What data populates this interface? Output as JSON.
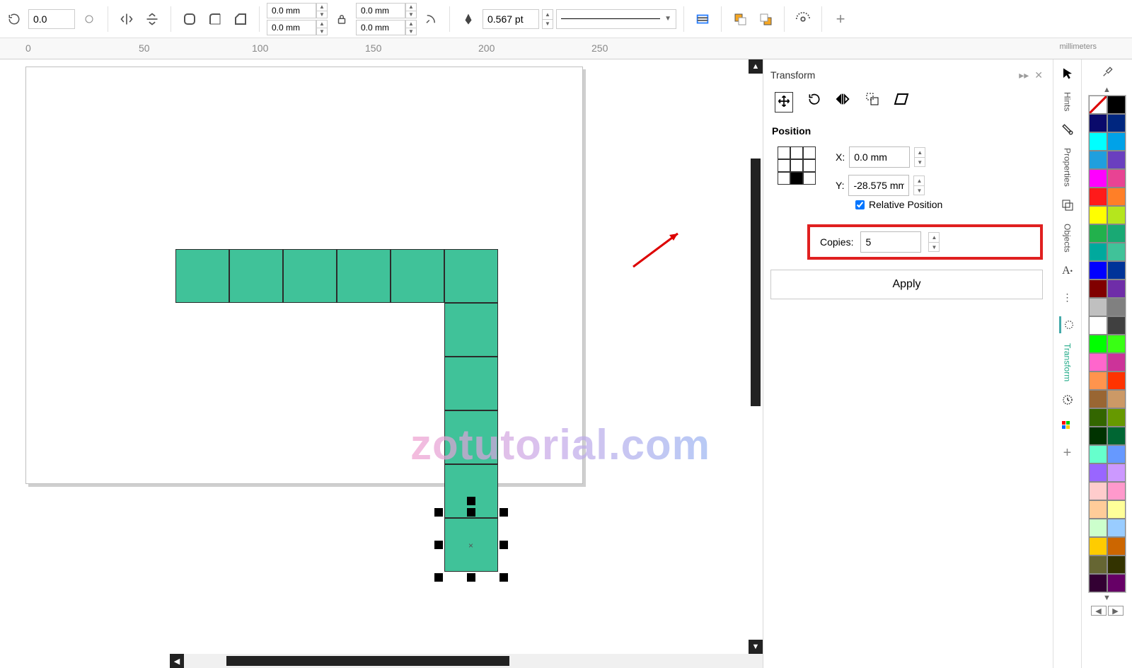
{
  "toolbar": {
    "rotation": "0.0",
    "corner1": "0.0 mm",
    "corner2": "0.0 mm",
    "corner3": "0.0 mm",
    "corner4": "0.0 mm",
    "outlineWidth": "0.567 pt"
  },
  "ruler": {
    "ticks": [
      "0",
      "50",
      "100",
      "150",
      "200",
      "250"
    ],
    "unit": "millimeters"
  },
  "panel": {
    "title": "Transform",
    "section": "Position",
    "xLabel": "X:",
    "xValue": "0.0 mm",
    "yLabel": "Y:",
    "yValue": "-28.575 mm",
    "relativeLabel": "Relative Position",
    "copiesLabel": "Copies:",
    "copiesValue": "5",
    "applyLabel": "Apply"
  },
  "rails": {
    "hints": "Hints",
    "properties": "Properties",
    "objects": "Objects",
    "transform": "Transform"
  },
  "palette": [
    [
      "pal-none",
      "#000000"
    ],
    [
      "#0a0a6b",
      "#00267f"
    ],
    [
      "#00ffff",
      "#00a2e8"
    ],
    [
      "#1f9fde",
      "#6a3fbf"
    ],
    [
      "#ff00ff",
      "#e84393"
    ],
    [
      "#ff1a1a",
      "#ff7f27"
    ],
    [
      "#ffff00",
      "#b5e61d"
    ],
    [
      "#22b14c",
      "#19a974"
    ],
    [
      "#00a99d",
      "#40c299"
    ],
    [
      "#0000ff",
      "#003399"
    ],
    [
      "#800000",
      "#6f2da8"
    ],
    [
      "#c0c0c0",
      "#808080"
    ],
    [
      "#ffffff",
      "#404040"
    ],
    [
      "#00ff00",
      "#39ff14"
    ],
    [
      "#ff66cc",
      "#cc3399"
    ],
    [
      "#ff944d",
      "#ff3300"
    ],
    [
      "#996633",
      "#cc9966"
    ],
    [
      "#336600",
      "#669900"
    ],
    [
      "#003300",
      "#006633"
    ],
    [
      "#66ffcc",
      "#6699ff"
    ],
    [
      "#9966ff",
      "#cc99ff"
    ],
    [
      "#ffcccc",
      "#ff99cc"
    ],
    [
      "#ffcc99",
      "#ffff99"
    ],
    [
      "#ccffcc",
      "#99ccff"
    ],
    [
      "#ffcc00",
      "#cc6600"
    ],
    [
      "#666633",
      "#333300"
    ],
    [
      "#330033",
      "#660066"
    ]
  ],
  "watermark": "zotutorial.com"
}
